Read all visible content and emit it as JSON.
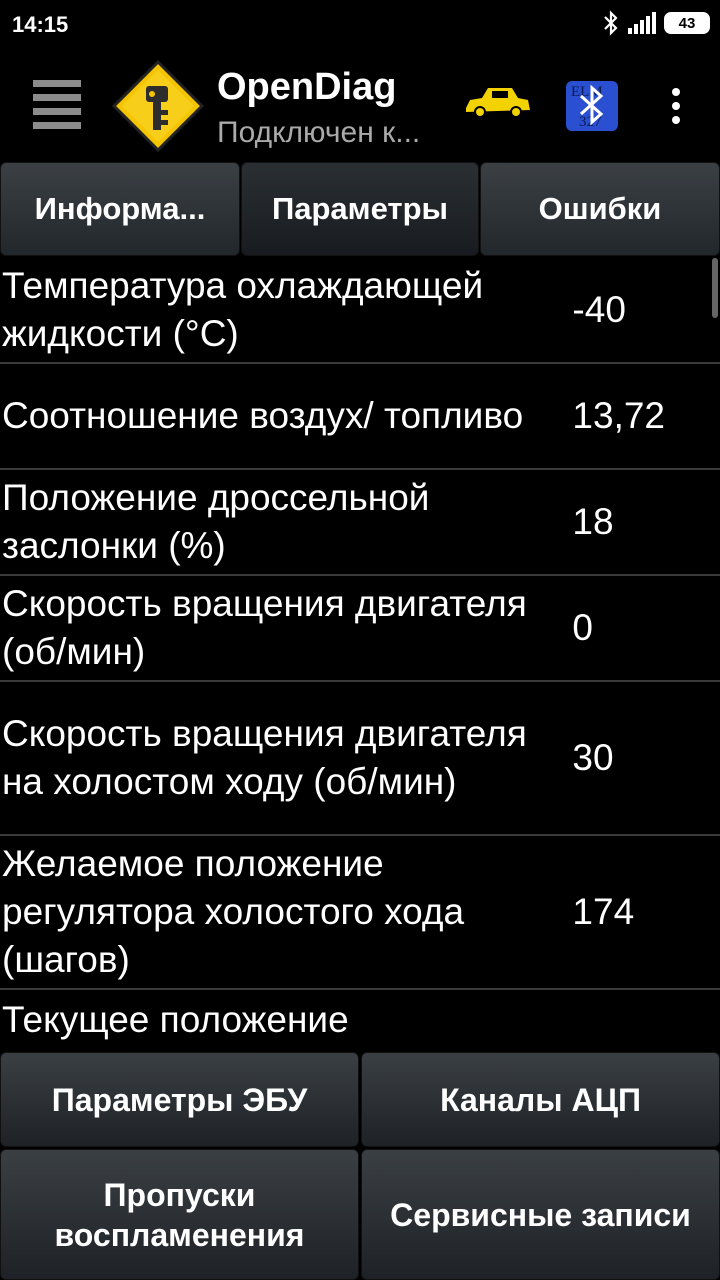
{
  "status": {
    "time": "14:15",
    "battery": "43"
  },
  "app": {
    "title": "OpenDiag",
    "subtitle": "Подключен к..."
  },
  "tabs": [
    {
      "label": "Информа..."
    },
    {
      "label": "Параметры"
    },
    {
      "label": "Ошибки"
    }
  ],
  "params": [
    {
      "label": "Температура охлаждающей жидкости (°C)",
      "value": "-40"
    },
    {
      "label": "Соотношение воздух/ топливо",
      "value": "13,72"
    },
    {
      "label": "Положение дроссельной заслонки (%)",
      "value": "18"
    },
    {
      "label": "Скорость вращения двигателя (об/мин)",
      "value": "0"
    },
    {
      "label": "Скорость вращения двигателя на холостом ходу (об/мин)",
      "value": "30"
    },
    {
      "label": "Желаемое положение регулятора холостого хода (шагов)",
      "value": "174"
    },
    {
      "label": "Текущее положение",
      "value": ""
    }
  ],
  "buttons": {
    "ecu_params": "Параметры ЭБУ",
    "adc_channels": "Каналы АЦП",
    "misfires": "Пропуски воспламенения",
    "service_records": "Сервисные записи"
  },
  "icons": {
    "menu": "hamburger-icon",
    "logo": "key-diamond-logo",
    "car": "car-icon",
    "bluetooth": "bluetooth-elm327-icon",
    "more": "more-vert-icon"
  },
  "colors": {
    "background": "#000000",
    "logo_yellow": "#f5c400",
    "car_yellow": "#f2d200",
    "bt_blue": "#2a4fd0"
  }
}
